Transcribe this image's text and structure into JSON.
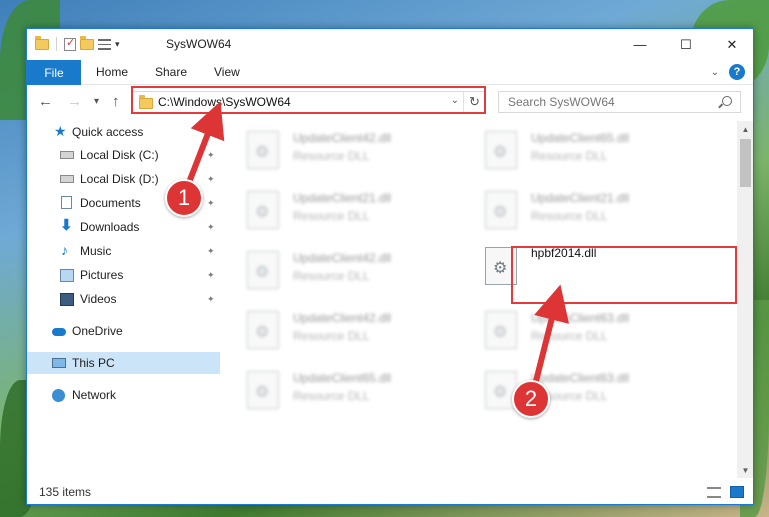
{
  "window": {
    "title": "SysWOW64",
    "minimize_glyph": "—",
    "maximize_glyph": "☐",
    "close_glyph": "✕"
  },
  "ribbon": {
    "file_tab": "File",
    "tabs": [
      "Home",
      "Share",
      "View"
    ]
  },
  "nav": {
    "back_glyph": "←",
    "forward_glyph": "→",
    "recent_glyph": "▾",
    "up_glyph": "↑",
    "address": "C:\\Windows\\SysWOW64",
    "address_dropdown_glyph": "⌄",
    "refresh_glyph": "↻",
    "search_placeholder": "Search SysWOW64"
  },
  "sidebar": {
    "items": [
      {
        "label": "Quick access",
        "icon": "star-icon",
        "pinned": false
      },
      {
        "label": "Local Disk (C:)",
        "icon": "drive-icon",
        "pinned": true
      },
      {
        "label": "Local Disk (D:)",
        "icon": "drive-icon",
        "pinned": true
      },
      {
        "label": "Documents",
        "icon": "documents-icon",
        "pinned": true
      },
      {
        "label": "Downloads",
        "icon": "download-icon",
        "pinned": true
      },
      {
        "label": "Music",
        "icon": "music-icon",
        "pinned": true
      },
      {
        "label": "Pictures",
        "icon": "pictures-icon",
        "pinned": true
      },
      {
        "label": "Videos",
        "icon": "videos-icon",
        "pinned": true
      },
      {
        "label": "OneDrive",
        "icon": "onedrive-icon",
        "pinned": false
      },
      {
        "label": "This PC",
        "icon": "this-pc-icon",
        "pinned": false,
        "selected": true
      },
      {
        "label": "Network",
        "icon": "network-icon",
        "pinned": false
      }
    ],
    "pin_glyph": "📌"
  },
  "files": [
    {
      "name": "UpdateClient42.dll",
      "type": "Resource DLL"
    },
    {
      "name": "UpdateClient65.dll",
      "type": "Resource DLL"
    },
    {
      "name": "UpdateClient21.dll",
      "type": "Resource DLL"
    },
    {
      "name": "UpdateClient21.dll",
      "type": "Resource DLL"
    },
    {
      "name": "UpdateClient42.dll",
      "type": "Resource DLL"
    },
    {
      "name": "UpdateClient42.dll",
      "type": "Resource DLL"
    },
    {
      "name": "UpdateClient63.dll",
      "type": "Resource DLL"
    },
    {
      "name": "UpdateClient65.dll",
      "type": "Resource DLL"
    },
    {
      "name": "UpdateClient63.dll",
      "type": "Resource DLL"
    }
  ],
  "highlighted_file": {
    "name": "hpbf2014.dll"
  },
  "status": {
    "item_count": "135 items"
  },
  "annotations": {
    "step1": "1",
    "step2": "2"
  },
  "colors": {
    "accent": "#1979ca",
    "annotation_red": "#dd3535",
    "selection": "#cce4f7"
  }
}
